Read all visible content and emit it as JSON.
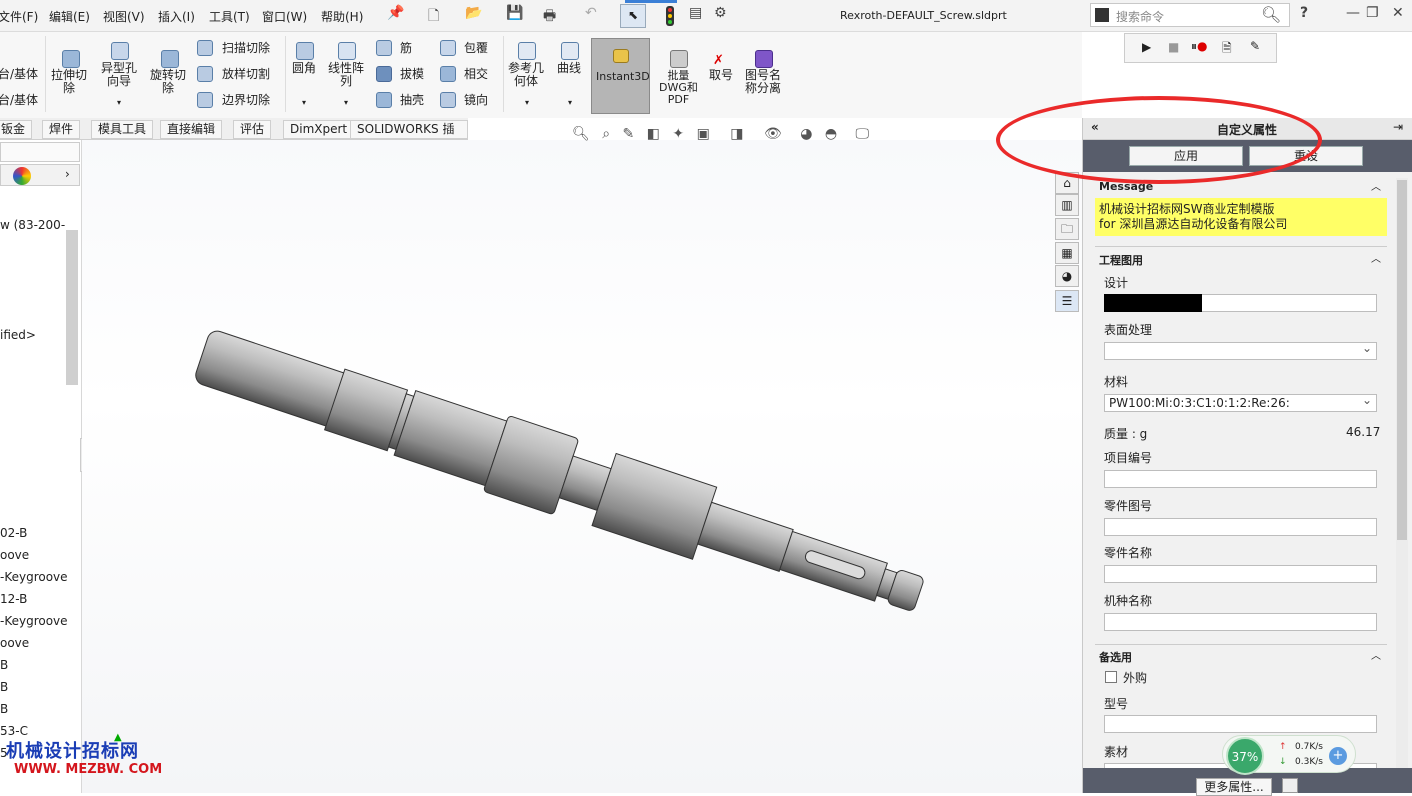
{
  "menubar": {
    "file": "文件(F)",
    "edit": "编辑(E)",
    "view": "视图(V)",
    "insert": "插入(I)",
    "tools": "工具(T)",
    "window": "窗口(W)",
    "help": "帮助(H)"
  },
  "window": {
    "title": "Rexroth-DEFAULT_Screw.sldprt"
  },
  "search": {
    "placeholder": "搜索命令"
  },
  "ribbon": {
    "boss_base": "台/基体",
    "cut_base": "台/基体",
    "extrude_cut": "拉伸切\n除",
    "hole_wizard": "异型孔\n向导",
    "revolve_cut": "旋转切\n除",
    "sweep_cut": "扫描切除",
    "loft_cut": "放样切割",
    "boundary_cut": "边界切除",
    "fillet": "圆角",
    "linear_pattern": "线性阵\n列",
    "rib": "筋",
    "wrap": "包覆",
    "draft": "拔模",
    "intersect": "相交",
    "shell": "抽壳",
    "mirror": "镜向",
    "ref_geometry": "参考几\n何体",
    "curves": "曲线",
    "instant3d": "Instant3D",
    "batch": "批量\nDWG和\nPDF",
    "get_number": "取号",
    "drawing_split": "图号名\n称分离"
  },
  "tabs": [
    "钣金",
    "焊件",
    "模具工具",
    "直接编辑",
    "评估",
    "DimXpert",
    "SOLIDWORKS 插件"
  ],
  "tree": [
    "w  (83-200-",
    "ified>",
    "02-B",
    "oove",
    "-Keygroove",
    "12-B",
    "-Keygroove",
    "oove",
    "B",
    "B",
    "B",
    "53-C",
    "5"
  ],
  "panel": {
    "title": "自定义属性",
    "apply": "应用",
    "reset": "重设",
    "message_title": "Message",
    "message_line1": "机械设计招标网SW商业定制模版",
    "message_line2": "for 深圳昌源达自动化设备有限公司",
    "drawing_title": "工程图用",
    "design": "设计",
    "surface": "表面处理",
    "material": "材料",
    "material_value": "PW100:Mi:0:3:C1:0:1:2:Re:26:",
    "mass_label": "质量 : g",
    "mass_value": "46.17",
    "item_no": "项目编号",
    "part_no": "零件图号",
    "part_name": "零件名称",
    "model_name": "机种名称",
    "optional_title": "备选用",
    "outsourced": "外购",
    "model": "型号",
    "raw": "素材",
    "more": "更多属性..."
  },
  "network": {
    "percent": "37%",
    "up": "0.7K/s",
    "down": "0.3K/s"
  },
  "watermark": {
    "line1": "机械设计招标网",
    "line2": "WWW. MEZBW. COM"
  }
}
